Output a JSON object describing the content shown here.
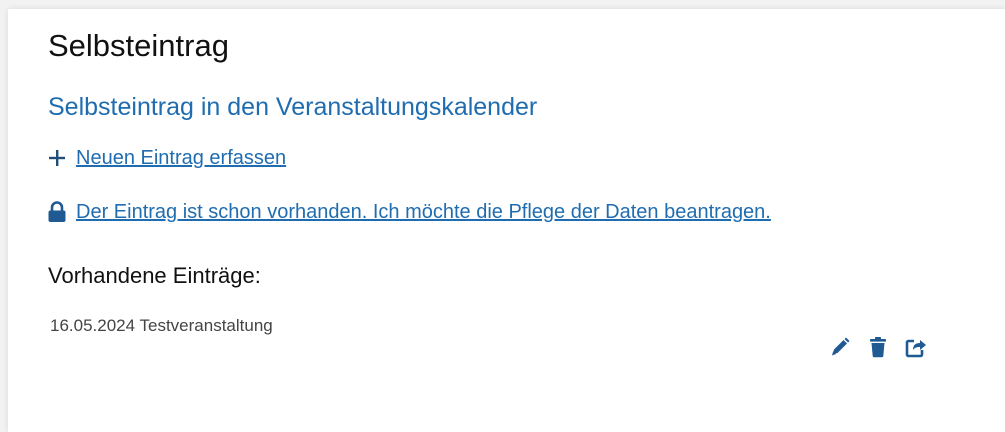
{
  "page": {
    "title": "Selbsteintrag"
  },
  "section": {
    "title": "Selbsteintrag in den Veranstaltungskalender",
    "new_entry_link": "Neuen Eintrag erfassen",
    "claim_entry_link": " Der Eintrag ist schon vorhanden. Ich möchte die Pflege der Daten beantragen."
  },
  "existing": {
    "heading": "Vorhandene Einträge:",
    "entries": [
      {
        "label": "16.05.2024 Testveranstaltung",
        "actions": [
          "pencil-icon",
          "trash-icon",
          "share-icon"
        ]
      }
    ]
  },
  "colors": {
    "link": "#1f6db0",
    "text": "#111111",
    "muted": "#444444",
    "background": "#f2f2f2"
  }
}
